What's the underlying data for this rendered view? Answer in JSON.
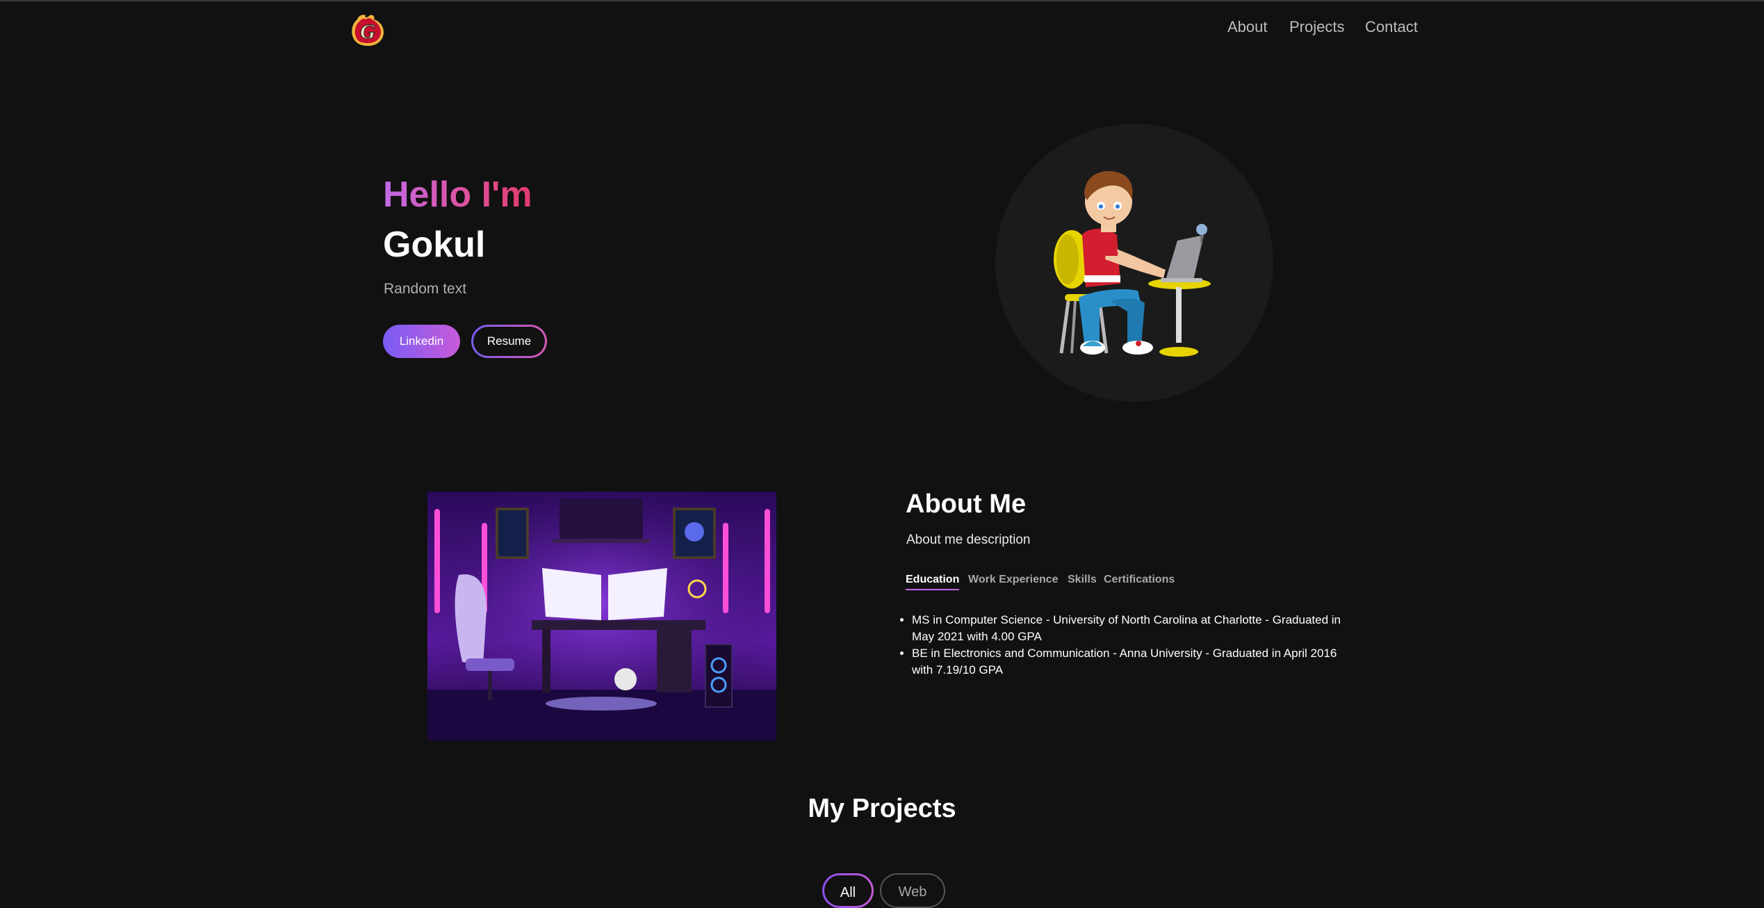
{
  "header": {
    "logo_letter": "G",
    "nav": [
      "About",
      "Projects",
      "Contact"
    ]
  },
  "hero": {
    "greeting": "Hello I'm",
    "name": "Gokul",
    "tagline": "Random text",
    "buttons": {
      "linkedin": "Linkedin",
      "resume": "Resume"
    }
  },
  "about": {
    "title": "About Me",
    "description": "About me description",
    "tabs": [
      "Education",
      "Work Experience",
      "Skills",
      "Certifications"
    ],
    "active_tab": "Education",
    "education": [
      "MS in Computer Science - University of North Carolina at Charlotte - Graduated in May 2021 with 4.00 GPA",
      "BE in Electronics and Communication - Anna University - Graduated in April 2016 with 7.19/10 GPA"
    ]
  },
  "projects": {
    "title": "My Projects",
    "filters": [
      "All",
      "Web"
    ],
    "active_filter": "All"
  },
  "colors": {
    "background": "#111111",
    "accent_purple": "#7a5cf5",
    "accent_pink": "#e0509a",
    "muted_text": "#b0b0b0"
  },
  "icons": {
    "logo": "flame-g-logo"
  }
}
